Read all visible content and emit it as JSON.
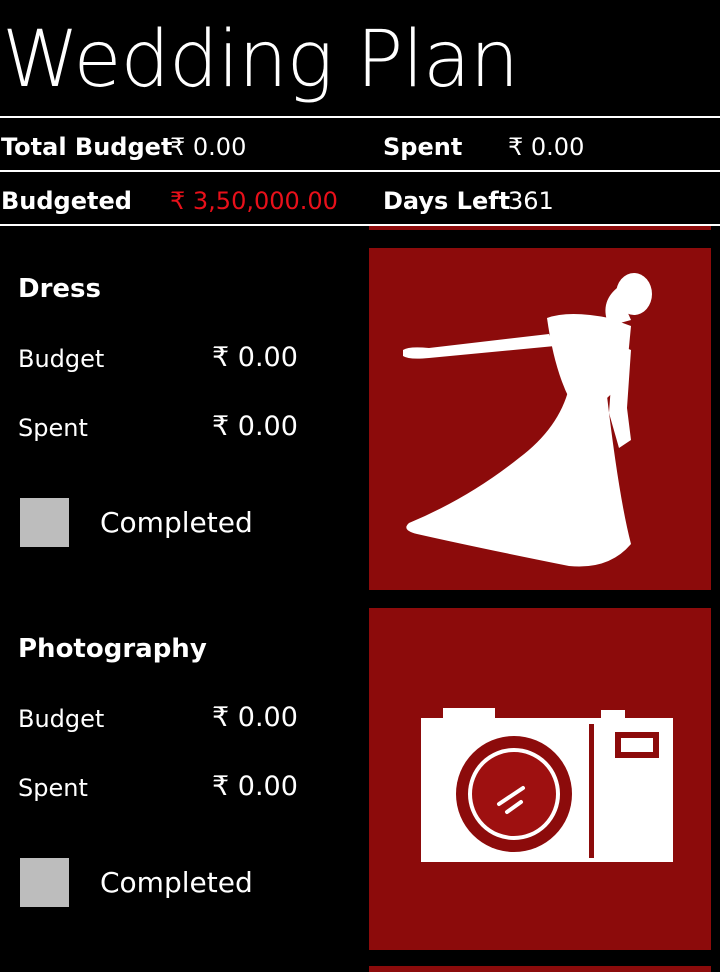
{
  "app": {
    "title": "Wedding Plan"
  },
  "summary": {
    "total_budget_label": "Total Budget",
    "total_budget_value": "₹ 0.00",
    "spent_label": "Spent",
    "spent_value": "₹ 0.00",
    "budgeted_label": "Budgeted",
    "budgeted_value": "₹ 3,50,000.00",
    "days_left_label": "Days Left",
    "days_left_value": "361"
  },
  "categories": [
    {
      "name": "Dress",
      "budget_label": "Budget",
      "budget_value": "₹ 0.00",
      "spent_label": "Spent",
      "spent_value": "₹ 0.00",
      "completed_label": "Completed",
      "completed": false,
      "icon": "bride-icon"
    },
    {
      "name": "Photography",
      "budget_label": "Budget",
      "budget_value": "₹ 0.00",
      "spent_label": "Spent",
      "spent_value": "₹ 0.00",
      "completed_label": "Completed",
      "completed": false,
      "icon": "camera-icon"
    }
  ],
  "colors": {
    "background": "#000000",
    "tile": "#8c0b0b",
    "accent_red": "#e8101a",
    "checkbox": "#bdbdbd"
  }
}
